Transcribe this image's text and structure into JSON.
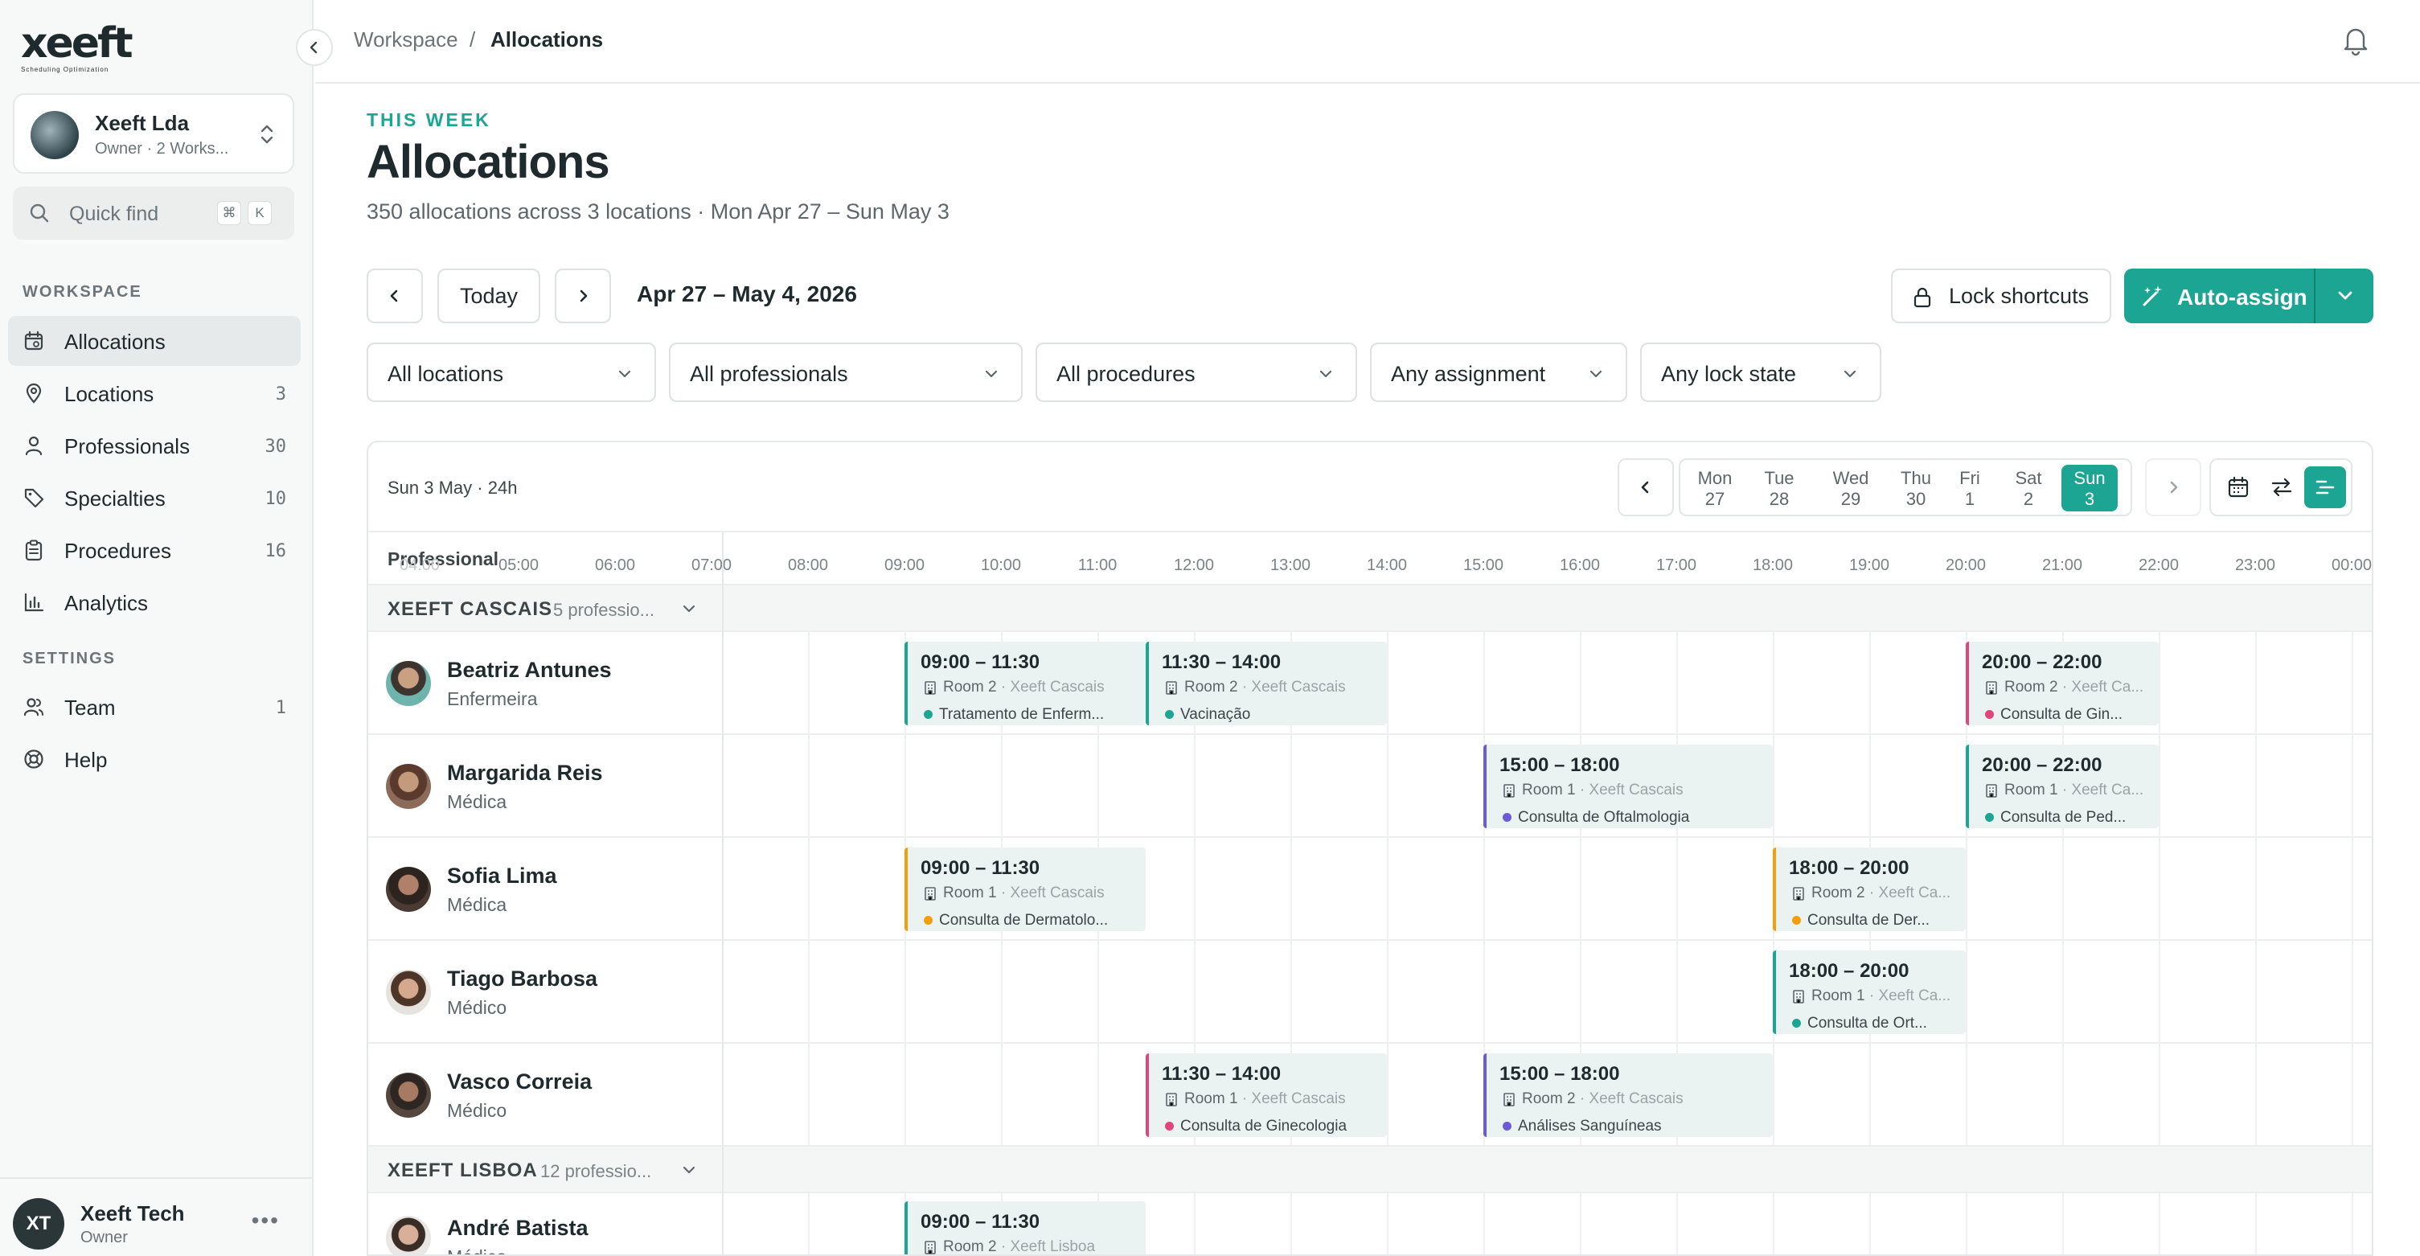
{
  "brand": {
    "logo": "xeeft",
    "tagline": "Scheduling Optimization"
  },
  "workspace": {
    "name": "Xeeft Lda",
    "role": "Owner · 2 Works..."
  },
  "quickfind": {
    "placeholder": "Quick find",
    "key1": "⌘",
    "key2": "K"
  },
  "sidebar": {
    "workspace_label": "WORKSPACE",
    "settings_label": "SETTINGS",
    "items": [
      {
        "label": "Allocations",
        "icon": "calendar-icon",
        "count": ""
      },
      {
        "label": "Locations",
        "icon": "pin-icon",
        "count": "3"
      },
      {
        "label": "Professionals",
        "icon": "user-icon",
        "count": "30"
      },
      {
        "label": "Specialties",
        "icon": "tag-icon",
        "count": "10"
      },
      {
        "label": "Procedures",
        "icon": "clipboard-icon",
        "count": "16"
      },
      {
        "label": "Analytics",
        "icon": "chart-icon",
        "count": ""
      }
    ],
    "settings_items": [
      {
        "label": "Team",
        "icon": "users-icon",
        "count": "1"
      },
      {
        "label": "Help",
        "icon": "help-icon",
        "count": ""
      }
    ]
  },
  "user": {
    "initials": "XT",
    "name": "Xeeft Tech",
    "role": "Owner"
  },
  "breadcrumb": {
    "root": "Workspace",
    "sep": "/",
    "current": "Allocations"
  },
  "page": {
    "eyebrow": "THIS WEEK",
    "title": "Allocations",
    "subtitle": "350 allocations across 3 locations · Mon Apr 27 – Sun May 3"
  },
  "toolbar": {
    "today": "Today",
    "range": "Apr 27 – May 4, 2026",
    "lock": "Lock shortcuts",
    "autoassign": "Auto-assign"
  },
  "filters": [
    "All locations",
    "All professionals",
    "All procedures",
    "Any assignment",
    "Any lock state"
  ],
  "scheduler": {
    "day_title": "Sun 3 May · 24h",
    "days": [
      {
        "dow": "Mon",
        "num": "27"
      },
      {
        "dow": "Tue",
        "num": "28"
      },
      {
        "dow": "Wed",
        "num": "29"
      },
      {
        "dow": "Thu",
        "num": "30"
      },
      {
        "dow": "Fri",
        "num": "1"
      },
      {
        "dow": "Sat",
        "num": "2"
      },
      {
        "dow": "Sun",
        "num": "3"
      }
    ],
    "professional_header": "Professional",
    "hours": [
      "04:00",
      "05:00",
      "06:00",
      "07:00",
      "08:00",
      "09:00",
      "10:00",
      "11:00",
      "12:00",
      "13:00",
      "14:00",
      "15:00",
      "16:00",
      "17:00",
      "18:00",
      "19:00",
      "20:00",
      "21:00",
      "22:00",
      "23:00",
      "00:00"
    ],
    "locations": [
      {
        "name": "XEEFT CASCAIS",
        "count": "5 professio..."
      },
      {
        "name": "XEEFT LISBOA",
        "count": "12 professio..."
      }
    ],
    "professionals": [
      {
        "name": "Beatriz Antunes",
        "role": "Enfermeira"
      },
      {
        "name": "Margarida Reis",
        "role": "Médica"
      },
      {
        "name": "Sofia Lima",
        "role": "Médica"
      },
      {
        "name": "Tiago Barbosa",
        "role": "Médico"
      },
      {
        "name": "Vasco Correia",
        "role": "Médico"
      },
      {
        "name": "André Batista",
        "role": "Médico"
      }
    ],
    "allocations": [
      {
        "time": "09:00 – 11:30",
        "room": "Room 2",
        "loc": "· Xeeft Cascais",
        "proc": "Tratamento de Enferm...",
        "color": "#1ca592"
      },
      {
        "time": "11:30 – 14:00",
        "room": "Room 2",
        "loc": "· Xeeft Cascais",
        "proc": "Vacinação",
        "color": "#1ca592"
      },
      {
        "time": "20:00 – 22:00",
        "room": "Room 2",
        "loc": "· Xeeft Ca...",
        "proc": "Consulta de Gin...",
        "color": "#e0457b"
      },
      {
        "time": "15:00 – 18:00",
        "room": "Room 1",
        "loc": "· Xeeft Cascais",
        "proc": "Consulta de Oftalmologia",
        "color": "#6b5bd6"
      },
      {
        "time": "20:00 – 22:00",
        "room": "Room 1",
        "loc": "· Xeeft Ca...",
        "proc": "Consulta de Ped...",
        "color": "#1ca592"
      },
      {
        "time": "09:00 – 11:30",
        "room": "Room 1",
        "loc": "· Xeeft Cascais",
        "proc": "Consulta de Dermatolo...",
        "color": "#f59e0b"
      },
      {
        "time": "18:00 – 20:00",
        "room": "Room 2",
        "loc": "· Xeeft Ca...",
        "proc": "Consulta de Der...",
        "color": "#f59e0b"
      },
      {
        "time": "18:00 – 20:00",
        "room": "Room 1",
        "loc": "· Xeeft Ca...",
        "proc": "Consulta de Ort...",
        "color": "#1ca592"
      },
      {
        "time": "11:30 – 14:00",
        "room": "Room 1",
        "loc": "· Xeeft Cascais",
        "proc": "Consulta de Ginecologia",
        "color": "#e0457b"
      },
      {
        "time": "15:00 – 18:00",
        "room": "Room 2",
        "loc": "· Xeeft Cascais",
        "proc": "Análises Sanguíneas",
        "color": "#6b5bd6"
      },
      {
        "time": "09:00 – 11:30",
        "room": "Room 2",
        "loc": "· Xeeft Lisboa",
        "proc": "",
        "color": "#1ca592"
      }
    ]
  },
  "colors": {
    "accent": "#1ca592"
  }
}
